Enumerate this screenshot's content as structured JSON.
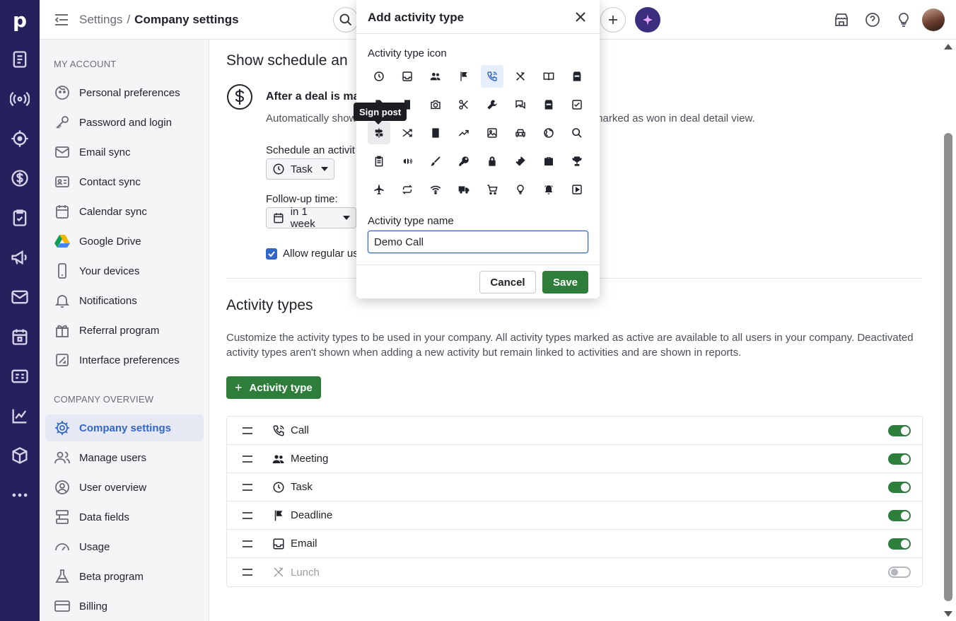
{
  "rail": {
    "logo": "p",
    "icons": [
      "deals-list-icon",
      "radar-icon",
      "target-icon",
      "dollar-icon",
      "task-icon",
      "megaphone-icon",
      "mail-icon",
      "calendar-icon",
      "contact-card-icon",
      "chart-icon",
      "box-icon",
      "more-icon"
    ]
  },
  "topbar": {
    "crumb_parent": "Settings",
    "crumb_separator": "/",
    "crumb_current": "Company settings"
  },
  "sidebar": {
    "my_account_heading": "MY ACCOUNT",
    "my_account": [
      {
        "label": "Personal preferences",
        "icon": "face-icon"
      },
      {
        "label": "Password and login",
        "icon": "key-icon"
      },
      {
        "label": "Email sync",
        "icon": "envelope-icon"
      },
      {
        "label": "Contact sync",
        "icon": "contact-card-icon"
      },
      {
        "label": "Calendar sync",
        "icon": "calendar-icon"
      },
      {
        "label": "Google Drive",
        "icon": "google-drive-icon"
      },
      {
        "label": "Your devices",
        "icon": "phone-icon"
      },
      {
        "label": "Notifications",
        "icon": "bell-icon"
      },
      {
        "label": "Referral program",
        "icon": "gift-icon"
      },
      {
        "label": "Interface preferences",
        "icon": "interface-icon"
      }
    ],
    "company_heading": "COMPANY OVERVIEW",
    "company": [
      {
        "label": "Company settings",
        "icon": "gear-icon"
      },
      {
        "label": "Manage users",
        "icon": "users-icon"
      },
      {
        "label": "User overview",
        "icon": "user-circle-icon"
      },
      {
        "label": "Data fields",
        "icon": "data-fields-icon"
      },
      {
        "label": "Usage",
        "icon": "gauge-icon"
      },
      {
        "label": "Beta program",
        "icon": "flask-icon"
      },
      {
        "label": "Billing",
        "icon": "credit-card-icon"
      }
    ]
  },
  "main": {
    "schedule_title": "Show schedule an",
    "after_title": "After a deal is ma",
    "after_desc": "Automatically show",
    "after_desc_tail": "marked as won in deal detail view.",
    "schedule_label": "Schedule an activit",
    "schedule_value": "Task",
    "followup_label": "Follow-up time:",
    "followup_value": "in 1 week",
    "allow_label": "Allow regular us",
    "activity_types_title": "Activity types",
    "activity_types_desc": "Customize the activity types to be used in your company. All activity types marked as active are available to all users in your company. Deactivated activity types aren't shown when adding a new activity but remain linked to activities and are shown in reports.",
    "add_button_plus": "+",
    "add_button_label": "Activity type",
    "types": [
      {
        "name": "Call",
        "icon": "call-icon",
        "active": true
      },
      {
        "name": "Meeting",
        "icon": "meeting-icon",
        "active": true
      },
      {
        "name": "Task",
        "icon": "task-clock-icon",
        "active": true
      },
      {
        "name": "Deadline",
        "icon": "flag-icon",
        "active": true
      },
      {
        "name": "Email",
        "icon": "inbox-icon",
        "active": true
      },
      {
        "name": "Lunch",
        "icon": "utensils-icon",
        "active": false
      }
    ]
  },
  "modal": {
    "title": "Add activity type",
    "icon_label": "Activity type icon",
    "selected_icon": "call-icon",
    "hovered_icon": "sign-post-icon",
    "tooltip": "Sign post",
    "icons": [
      "clock-icon",
      "inbox-icon",
      "users-icon",
      "flag-icon",
      "call-icon",
      "utensils-icon",
      "book-icon",
      "archive-icon",
      "document-icon",
      "building-icon",
      "camera-icon",
      "scissors-icon",
      "wrench-icon",
      "chat-icon",
      "package-icon",
      "checkbox-icon",
      "sign-post-icon",
      "shuffle-icon",
      "address-book-icon",
      "trend-icon",
      "image-icon",
      "car-icon",
      "globe-icon",
      "search-icon",
      "clipboard-icon",
      "speaker-icon",
      "brush-icon",
      "key-icon",
      "lock-icon",
      "ticket-icon",
      "briefcase-icon",
      "trophy-icon",
      "plane-icon",
      "refresh-icon",
      "wifi-icon",
      "truck-icon",
      "cart-icon",
      "bulb-icon",
      "alarm-icon",
      "play-icon"
    ],
    "name_label": "Activity type name",
    "name_value": "Demo Call",
    "cancel_label": "Cancel",
    "save_label": "Save"
  }
}
